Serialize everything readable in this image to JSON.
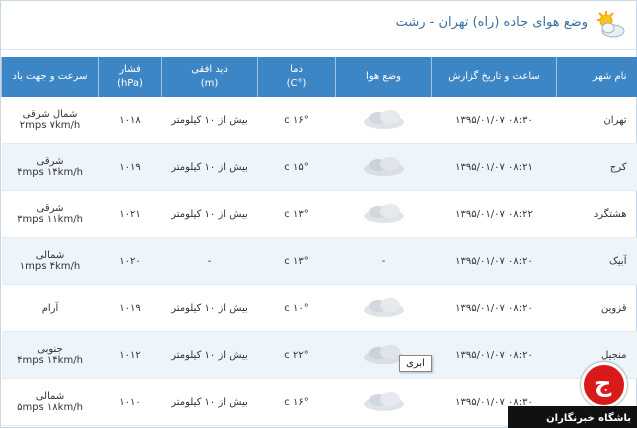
{
  "page": {
    "title": "وضع هوای جاده (راه) تهران - رشت"
  },
  "headers": {
    "city": "نام شهر",
    "time": "ساعت و تاریخ گزارش",
    "weather": "وضع هوا",
    "temp": "دما",
    "temp_unit": "(°C)",
    "visibility": "دید افقی",
    "visibility_unit": "(m)",
    "pressure": "فشار",
    "pressure_unit": "(hPa)",
    "wind": "سرعت و جهت باد"
  },
  "rows": [
    {
      "city": "تهران",
      "time": "۰۸:۳۰   ۱۳۹۵/۰۱/۰۷",
      "temp": "۱۶° c",
      "visibility": "بیش از ۱۰ کیلومتر",
      "pressure": "۱۰۱۸",
      "wind_dir": "شمال شرقی",
      "wind_speed": "۲mps  ۷km/h"
    },
    {
      "city": "کرج",
      "time": "۰۸:۲۱   ۱۳۹۵/۰۱/۰۷",
      "temp": "۱۵° c",
      "visibility": "بیش از ۱۰ کیلومتر",
      "pressure": "۱۰۱۹",
      "wind_dir": "شرقی",
      "wind_speed": "۴mps  ۱۴km/h"
    },
    {
      "city": "هشتگرد",
      "time": "۰۸:۲۲   ۱۳۹۵/۰۱/۰۷",
      "temp": "۱۳° c",
      "visibility": "بیش از ۱۰ کیلومتر",
      "pressure": "۱۰۲۱",
      "wind_dir": "شرقی",
      "wind_speed": "۳mps  ۱۱km/h"
    },
    {
      "city": "آبیک",
      "time": "۰۸:۲۰   ۱۳۹۵/۰۱/۰۷",
      "temp": "۱۳° c",
      "visibility": "-",
      "weather_text": "-",
      "pressure": "۱۰۲۰",
      "wind_dir": "شمالی",
      "wind_speed": "۱mps  ۴km/h"
    },
    {
      "city": "قزوین",
      "time": "۰۸:۲۰   ۱۳۹۵/۰۱/۰۷",
      "temp": "۱۰° c",
      "visibility": "بیش از ۱۰ کیلومتر",
      "pressure": "۱۰۱۹",
      "wind_dir": "آرام",
      "wind_speed": ""
    },
    {
      "city": "منجیل",
      "time": "۰۸:۲۰   ۱۳۹۵/۰۱/۰۷",
      "temp": "۲۲° c",
      "visibility": "بیش از ۱۰ کیلومتر",
      "pressure": "۱۰۱۲",
      "wind_dir": "جنوبی",
      "wind_speed": "۴mps  ۱۴km/h"
    },
    {
      "city": "",
      "time": "۰۸:۳۰   ۱۳۹۵/۰۱/۰۷",
      "temp": "۱۶° c",
      "visibility": "بیش از ۱۰ کیلومتر",
      "pressure": "۱۰۱۰",
      "wind_dir": "شمالی",
      "wind_speed": "۵mps  ۱۸km/h"
    }
  ],
  "tooltip": "ابری",
  "logo": {
    "text": "باشگاه خبرنگاران"
  },
  "colors": {
    "header_bg": "#3c86c6",
    "alt_row": "#edf4fa",
    "title": "#3a6fa0",
    "logo_red": "#d91a1a"
  }
}
